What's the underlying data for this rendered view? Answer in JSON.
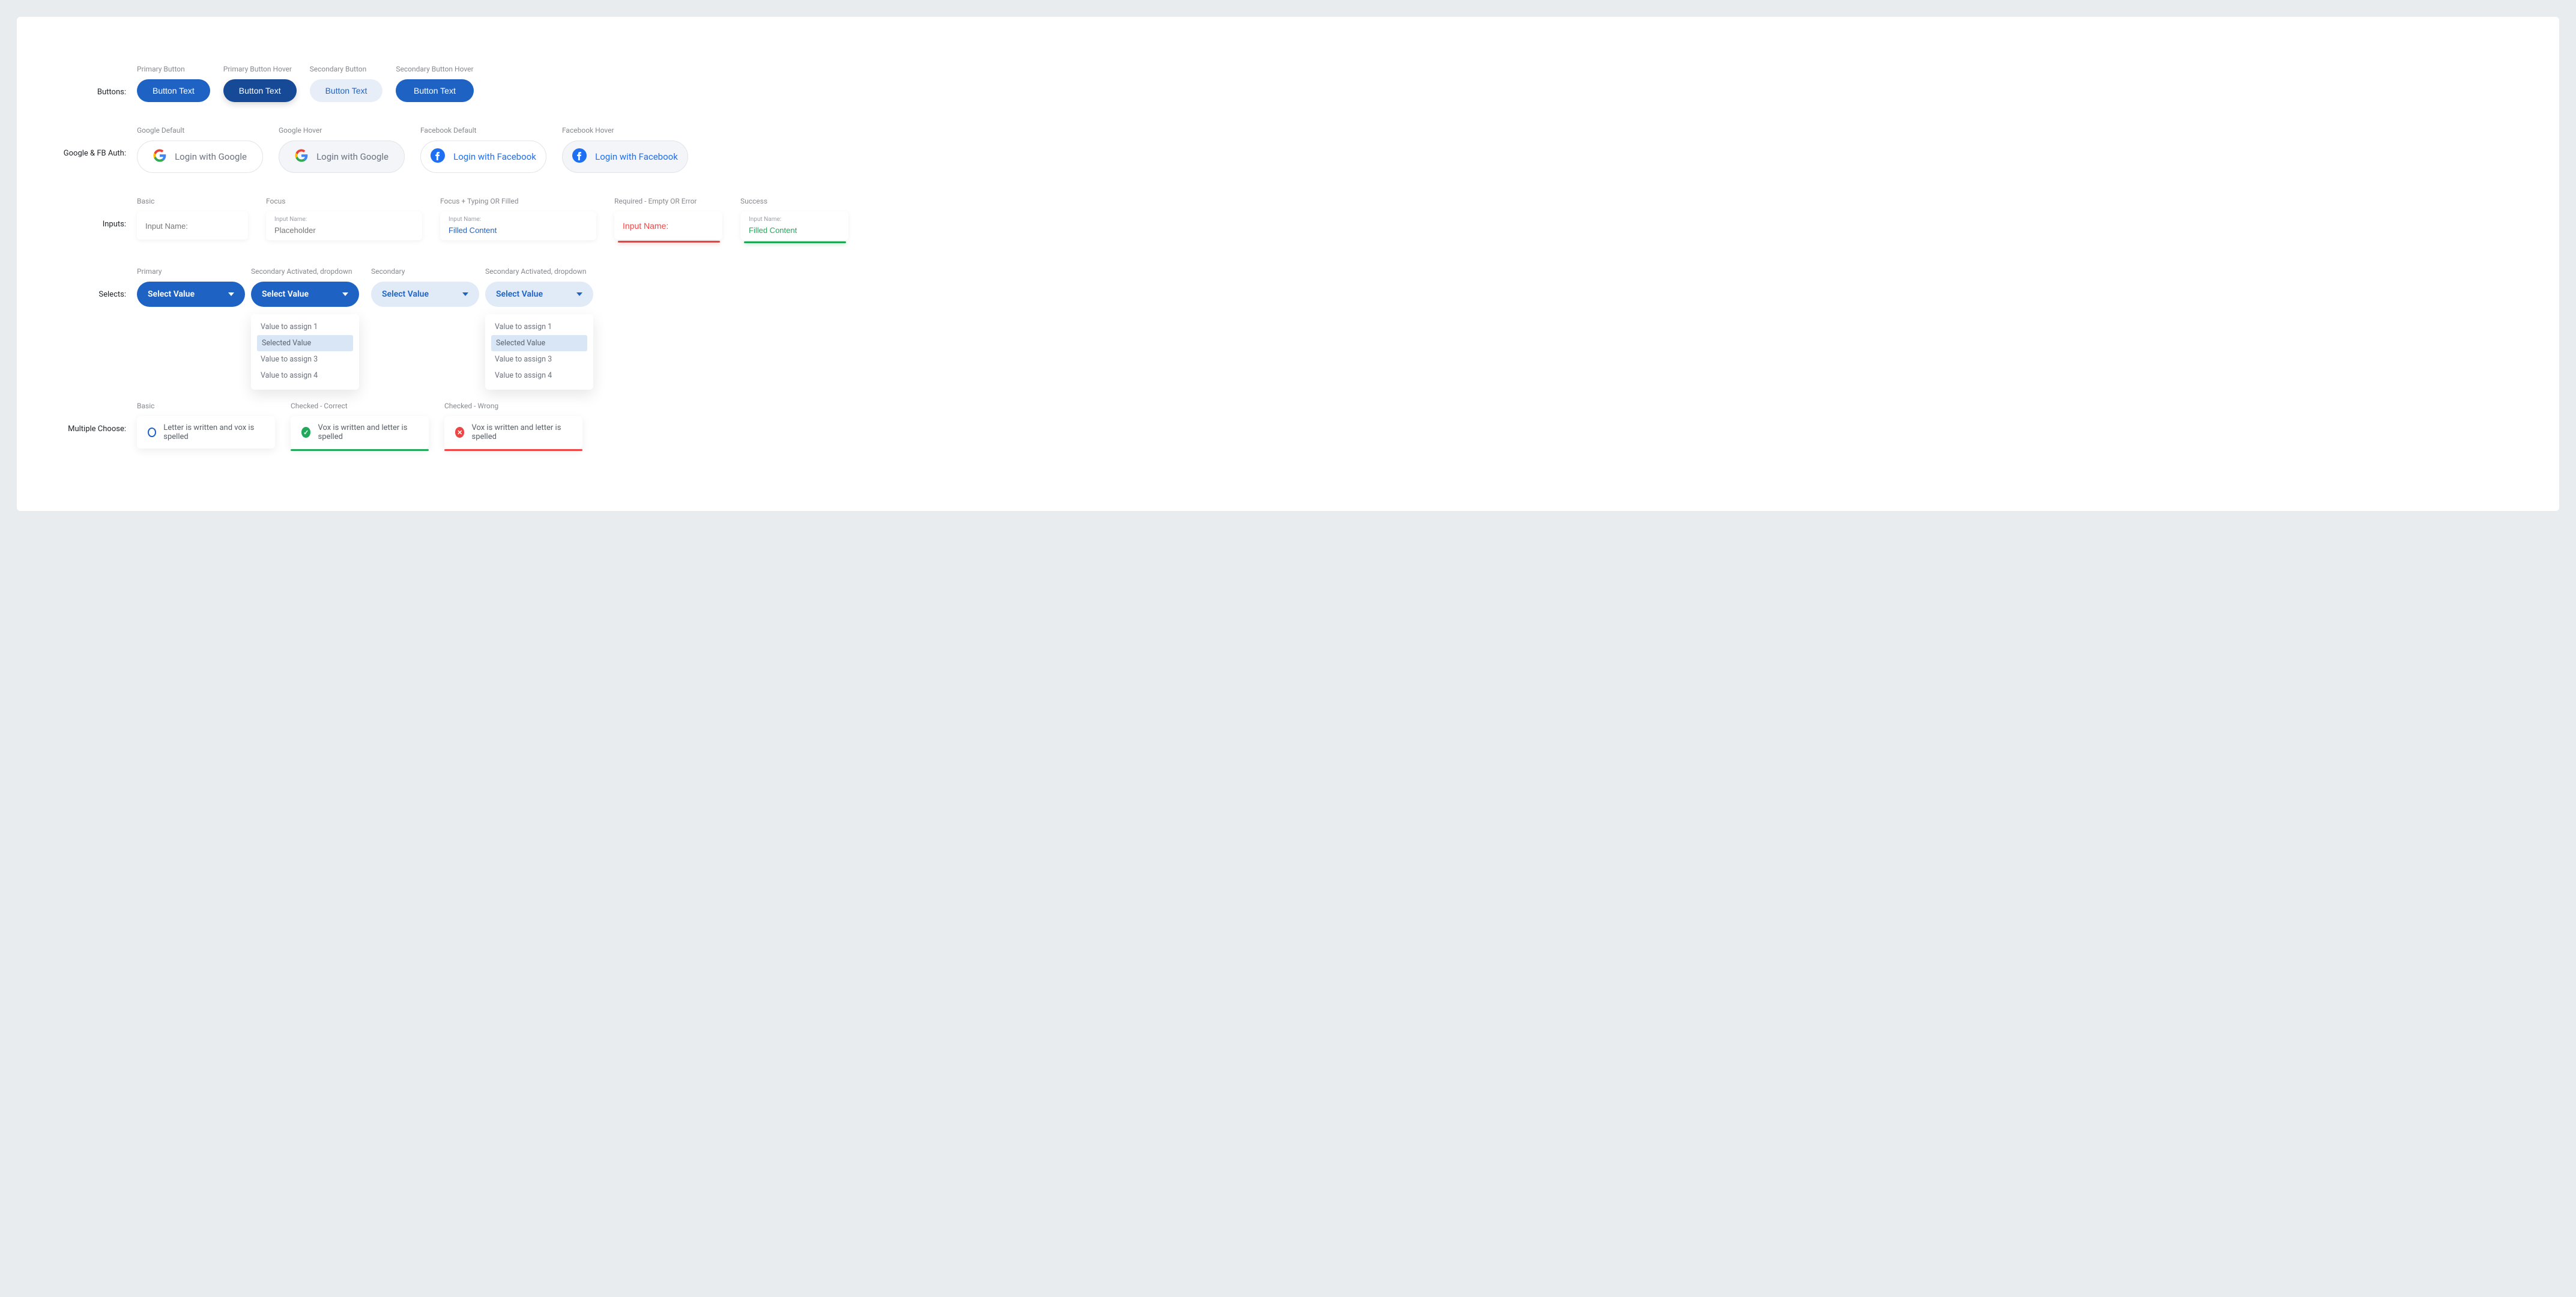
{
  "rows": {
    "buttons": {
      "label": "Buttons:",
      "primary": {
        "state": "Primary Button",
        "text": "Button Text"
      },
      "primary_hover": {
        "state": "Primary Button Hover",
        "text": "Button Text"
      },
      "secondary": {
        "state": "Secondary Button",
        "text": "Button Text"
      },
      "secondary_hover": {
        "state": "Secondary Button Hover",
        "text": "Button Text"
      }
    },
    "auth": {
      "label": "Google & FB Auth:",
      "google_default": {
        "state": "Google Default",
        "text": "Login with Google"
      },
      "google_hover": {
        "state": "Google Hover",
        "text": "Login with Google"
      },
      "fb_default": {
        "state": "Facebook Default",
        "text": "Login with Facebook"
      },
      "fb_hover": {
        "state": "Facebook Hover",
        "text": "Login with Facebook"
      }
    },
    "inputs": {
      "label": "Inputs:",
      "basic": {
        "state": "Basic",
        "placeholder": "Input Name:"
      },
      "focus": {
        "state": "Focus",
        "mini": "Input Name:",
        "placeholder": "Placeholder"
      },
      "filled": {
        "state": "Focus + Typing OR Filled",
        "mini": "Input Name:",
        "value": "Filled Content"
      },
      "error": {
        "state": "Required - Empty OR Error",
        "value": "Input Name:"
      },
      "success": {
        "state": "Success",
        "mini": "Input Name:",
        "value": "Filled Content"
      }
    },
    "selects": {
      "label": "Selects:",
      "primary": {
        "state": "Primary",
        "text": "Select Value"
      },
      "prim_drop": {
        "state": "Secondary Activated, dropdown",
        "text": "Select Value",
        "options": [
          "Value to assign 1",
          "Selected Value",
          "Value to assign 3",
          "Value to assign 4"
        ],
        "selected_index": 1
      },
      "secondary": {
        "state": "Secondary",
        "text": "Select Value"
      },
      "sec_drop": {
        "state": "Secondary Activated, dropdown",
        "text": "Select Value",
        "options": [
          "Value to assign 1",
          "Selected Value",
          "Value to assign 3",
          "Value to assign 4"
        ],
        "selected_index": 1
      }
    },
    "choices": {
      "label": "Multiple Choose:",
      "basic": {
        "state": "Basic",
        "text": "Letter is written and vox is spelled"
      },
      "correct": {
        "state": "Checked - Correct",
        "text": "Vox is written and letter is spelled"
      },
      "wrong": {
        "state": "Checked - Wrong",
        "text": "Vox is written and letter is spelled"
      }
    }
  },
  "icons": {
    "check": "✓",
    "cross": "✕"
  }
}
